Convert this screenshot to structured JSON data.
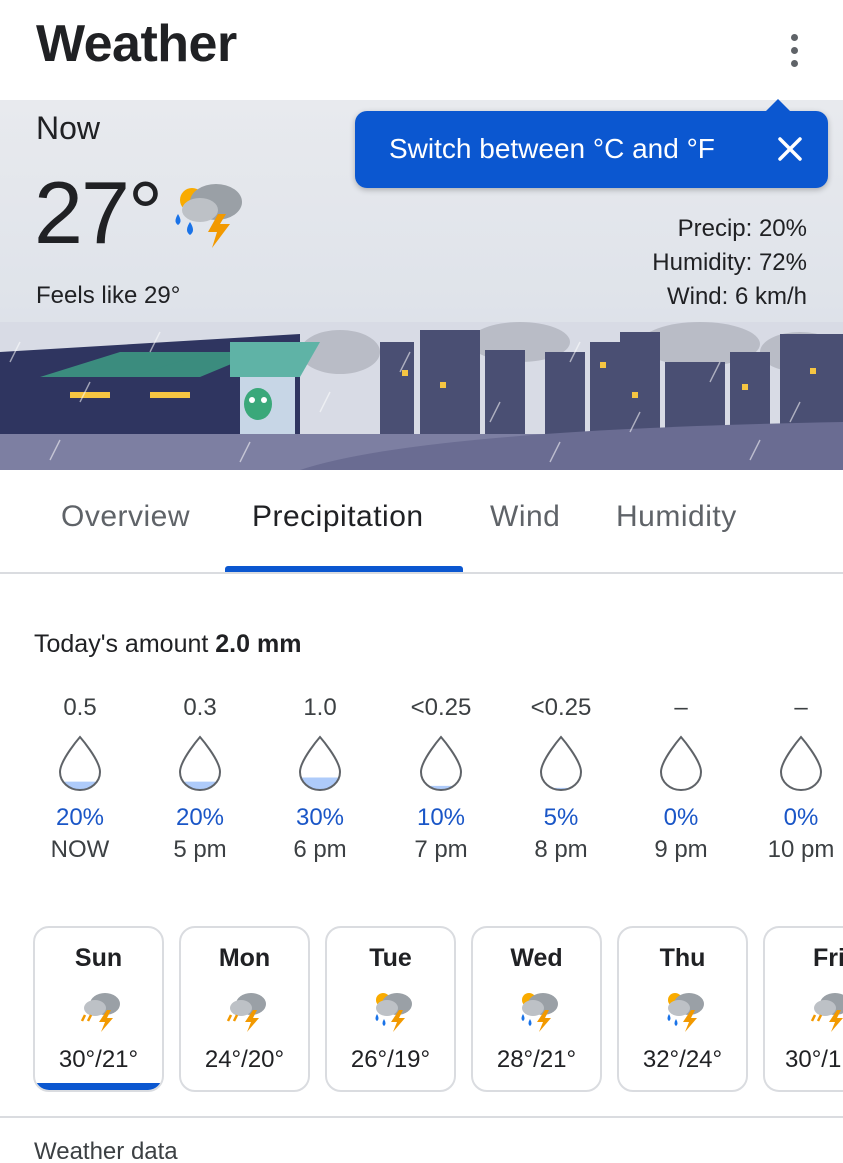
{
  "app": {
    "title": "Weather"
  },
  "current": {
    "label": "Now",
    "temperature": "27°",
    "feels_like": "Feels like 29°",
    "precip": "Precip: 20%",
    "humidity": "Humidity: 72%",
    "wind": "Wind: 6 km/h",
    "icon": "thunderstorm-rain-icon"
  },
  "tooltip": {
    "text": "Switch between °C and °F"
  },
  "tabs": [
    {
      "label": "Overview",
      "active": false
    },
    {
      "label": "Precipitation",
      "active": true
    },
    {
      "label": "Wind",
      "active": false
    },
    {
      "label": "Humidity",
      "active": false
    }
  ],
  "today": {
    "prefix": "Today's amount",
    "value": "2.0 mm"
  },
  "hourly": [
    {
      "amount": "0.5",
      "chance": "20%",
      "chance_value": 20,
      "time": "NOW"
    },
    {
      "amount": "0.3",
      "chance": "20%",
      "chance_value": 20,
      "time": "5 pm"
    },
    {
      "amount": "1.0",
      "chance": "30%",
      "chance_value": 30,
      "time": "6 pm"
    },
    {
      "amount": "<0.25",
      "chance": "10%",
      "chance_value": 10,
      "time": "7 pm"
    },
    {
      "amount": "<0.25",
      "chance": "5%",
      "chance_value": 5,
      "time": "8 pm"
    },
    {
      "amount": "–",
      "chance": "0%",
      "chance_value": 0,
      "time": "9 pm"
    },
    {
      "amount": "–",
      "chance": "0%",
      "chance_value": 0,
      "time": "10 pm"
    }
  ],
  "daily": [
    {
      "day": "Sun",
      "range": "30°/21°",
      "icon": "thunderstorm-icon",
      "selected": true
    },
    {
      "day": "Mon",
      "range": "24°/20°",
      "icon": "thunderstorm-icon",
      "selected": false
    },
    {
      "day": "Tue",
      "range": "26°/19°",
      "icon": "thunderstorm-rain-icon",
      "selected": false
    },
    {
      "day": "Wed",
      "range": "28°/21°",
      "icon": "thunderstorm-rain-icon",
      "selected": false
    },
    {
      "day": "Thu",
      "range": "32°/24°",
      "icon": "thunderstorm-rain-icon",
      "selected": false
    },
    {
      "day": "Fri",
      "range": "30°/1",
      "icon": "thunderstorm-icon",
      "selected": false
    }
  ],
  "footer": {
    "label": "Weather data"
  },
  "colors": {
    "accent": "#0b57d0",
    "chance_text": "#1a56c7",
    "drop_fill": "#aecbfa",
    "lightning": "#f29900",
    "rain_drop": "#1a73e8"
  }
}
